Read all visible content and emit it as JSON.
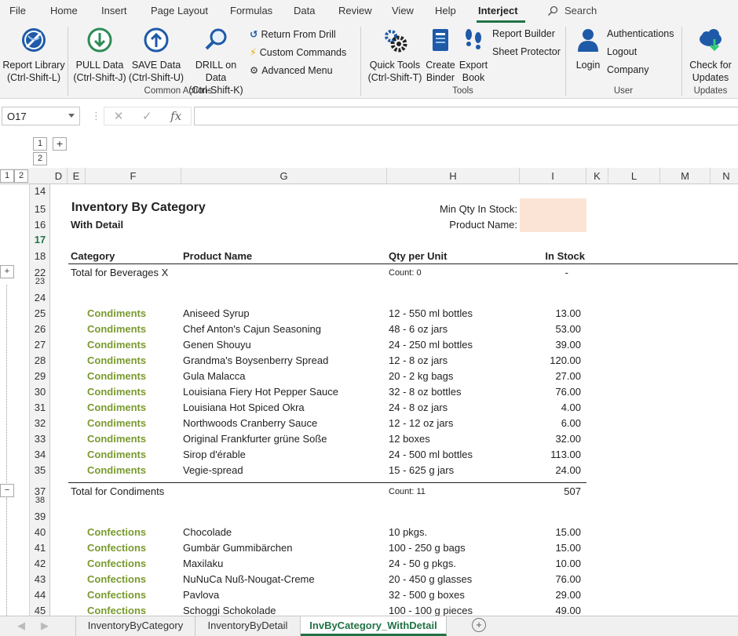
{
  "ribbon_tabs": [
    "File",
    "Home",
    "Insert",
    "Page Layout",
    "Formulas",
    "Data",
    "Review",
    "View",
    "Help",
    "Interject"
  ],
  "active_tab": "Interject",
  "search_label": "Search",
  "common_actions": {
    "report_library": [
      "Report Library",
      "(Ctrl-Shift-L)"
    ],
    "pull_data": [
      "PULL Data",
      "(Ctrl-Shift-J)"
    ],
    "save_data": [
      "SAVE Data",
      "(Ctrl-Shift-U)"
    ],
    "drill_data": [
      "DRILL on Data",
      "(Ctrl-Shift-K)"
    ],
    "return_drill": "Return From Drill",
    "custom_commands": "Custom Commands",
    "advanced_menu": "Advanced Menu",
    "group_label": "Common Actions"
  },
  "tools": {
    "quick_tools": [
      "Quick Tools",
      "(Ctrl-Shift-T)"
    ],
    "create_binder": [
      "Create",
      "Binder"
    ],
    "export_book": [
      "Export",
      "Book"
    ],
    "report_builder": "Report Builder",
    "sheet_protector": "Sheet Protector",
    "group_label": "Tools"
  },
  "user": {
    "login": "Login",
    "authentications": "Authentications",
    "logout": "Logout",
    "company": "Company",
    "group_label": "User"
  },
  "updates": {
    "check": [
      "Check for",
      "Updates"
    ],
    "group_label": "Updates"
  },
  "formula_bar": {
    "name_box": "O17",
    "fx": "fx"
  },
  "outline": {
    "levels_top": [
      "1",
      "2"
    ],
    "levels_left": [
      "1",
      "2"
    ],
    "plus": "+",
    "minus": "−"
  },
  "columns": [
    "D",
    "E",
    "F",
    "G",
    "H",
    "I",
    "K",
    "L",
    "M",
    "N"
  ],
  "report": {
    "title": "Inventory By Category",
    "subtitle": "With Detail",
    "param_min_qty": "Min Qty In Stock:",
    "param_product": "Product Name:",
    "headers": {
      "category": "Category",
      "product": "Product Name",
      "qty": "Qty per Unit",
      "stock": "In Stock"
    },
    "total_beverages": {
      "label": "Total for Beverages X",
      "count": "Count: 0",
      "value": "-"
    },
    "condiments": [
      {
        "row": "25",
        "cat": "Condiments",
        "product": "Aniseed Syrup",
        "qty": "12 - 550 ml bottles",
        "stock": "13.00"
      },
      {
        "row": "26",
        "cat": "Condiments",
        "product": "Chef Anton's Cajun Seasoning",
        "qty": "48 - 6 oz jars",
        "stock": "53.00"
      },
      {
        "row": "27",
        "cat": "Condiments",
        "product": "Genen Shouyu",
        "qty": "24 - 250 ml bottles",
        "stock": "39.00"
      },
      {
        "row": "28",
        "cat": "Condiments",
        "product": "Grandma's Boysenberry Spread",
        "qty": "12 - 8 oz jars",
        "stock": "120.00"
      },
      {
        "row": "29",
        "cat": "Condiments",
        "product": "Gula Malacca",
        "qty": "20 - 2 kg bags",
        "stock": "27.00"
      },
      {
        "row": "30",
        "cat": "Condiments",
        "product": "Louisiana Fiery Hot Pepper Sauce",
        "qty": "32 - 8 oz bottles",
        "stock": "76.00"
      },
      {
        "row": "31",
        "cat": "Condiments",
        "product": "Louisiana Hot Spiced Okra",
        "qty": "24 - 8 oz jars",
        "stock": "4.00"
      },
      {
        "row": "32",
        "cat": "Condiments",
        "product": "Northwoods Cranberry Sauce",
        "qty": "12 - 12 oz jars",
        "stock": "6.00"
      },
      {
        "row": "33",
        "cat": "Condiments",
        "product": "Original Frankfurter grüne Soße",
        "qty": "12 boxes",
        "stock": "32.00"
      },
      {
        "row": "34",
        "cat": "Condiments",
        "product": "Sirop d'érable",
        "qty": "24 - 500 ml bottles",
        "stock": "113.00"
      },
      {
        "row": "35",
        "cat": "Condiments",
        "product": "Vegie-spread",
        "qty": "15 - 625 g jars",
        "stock": "24.00"
      }
    ],
    "total_condiments": {
      "label": "Total for Condiments",
      "count": "Count: 11",
      "value": "507"
    },
    "confections": [
      {
        "row": "40",
        "cat": "Confections",
        "product": "Chocolade",
        "qty": "10 pkgs.",
        "stock": "15.00"
      },
      {
        "row": "41",
        "cat": "Confections",
        "product": "Gumbär Gummibärchen",
        "qty": "100 - 250 g bags",
        "stock": "15.00"
      },
      {
        "row": "42",
        "cat": "Confections",
        "product": "Maxilaku",
        "qty": "24 - 50 g pkgs.",
        "stock": "10.00"
      },
      {
        "row": "43",
        "cat": "Confections",
        "product": "NuNuCa Nuß-Nougat-Creme",
        "qty": "20 - 450 g glasses",
        "stock": "76.00"
      },
      {
        "row": "44",
        "cat": "Confections",
        "product": "Pavlova",
        "qty": "32 - 500 g boxes",
        "stock": "29.00"
      },
      {
        "row": "45",
        "cat": "Confections",
        "product": "Schoggi Schokolade",
        "qty": "100 - 100 g pieces",
        "stock": "49.00"
      }
    ]
  },
  "row_numbers": {
    "r14": "14",
    "r15": "15",
    "r16": "16",
    "r17": "17",
    "r18": "18",
    "r22": "22",
    "r23": "23",
    "r24": "24",
    "r37": "37",
    "r38": "38",
    "r39": "39"
  },
  "sheet_tabs": [
    "InventoryByCategory",
    "InventoryByDetail",
    "InvByCategory_WithDetail"
  ],
  "active_sheet": "InvByCategory_WithDetail",
  "colors": {
    "accent": "#217346",
    "category": "#7a9a2e",
    "param_fill": "#fbe4d6"
  }
}
